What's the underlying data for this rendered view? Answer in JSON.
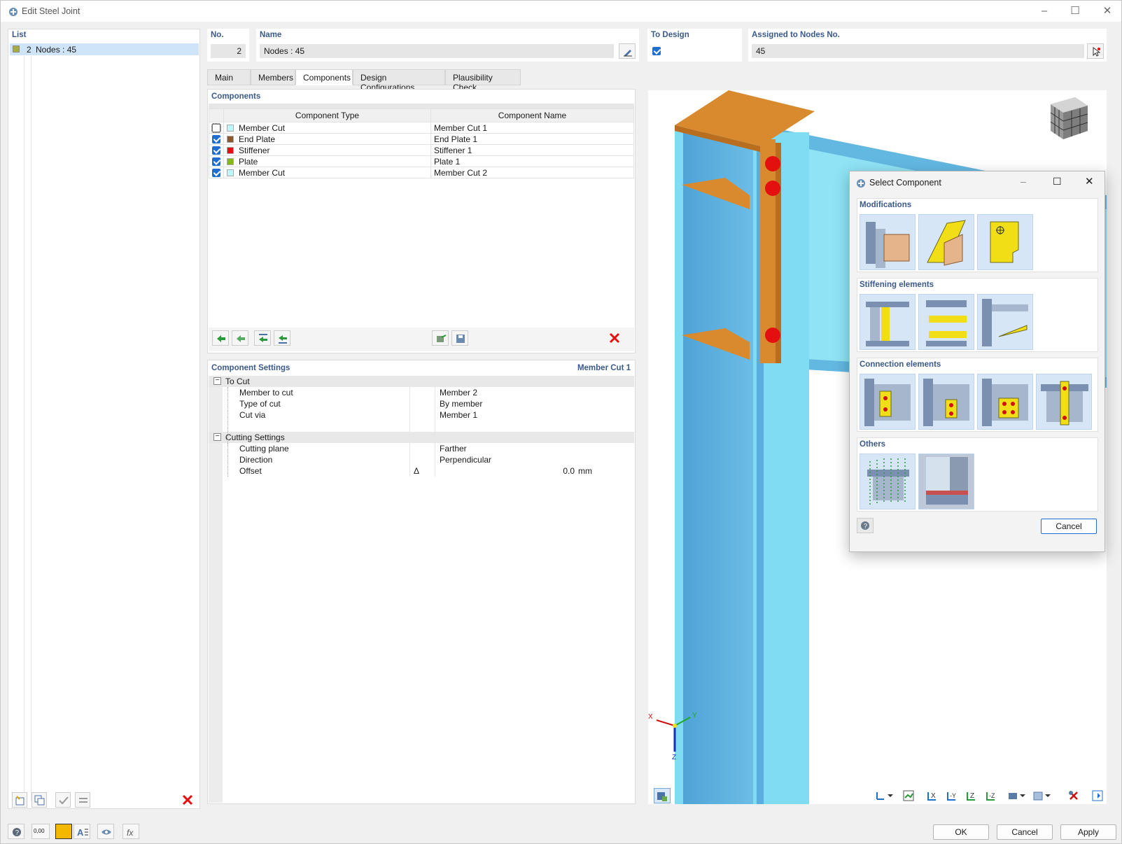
{
  "window": {
    "title": "Edit Steel Joint",
    "icon": "steel-joint-icon"
  },
  "list": {
    "header": "List",
    "item": {
      "number": "2",
      "name": "Nodes : 45",
      "color": "#a6ad3e"
    }
  },
  "no": {
    "label": "No.",
    "value": "2"
  },
  "name": {
    "label": "Name",
    "value": "Nodes : 45"
  },
  "to_design": {
    "label": "To Design",
    "checked": true
  },
  "assigned": {
    "label": "Assigned to Nodes No.",
    "value": "45"
  },
  "tabs": [
    {
      "label": "Main",
      "active": false
    },
    {
      "label": "Members",
      "active": false
    },
    {
      "label": "Components",
      "active": true
    },
    {
      "label": "Design Configurations",
      "active": false
    },
    {
      "label": "Plausibility Check",
      "active": false
    }
  ],
  "components": {
    "header": "Components",
    "col_type": "Component Type",
    "col_name": "Component Name",
    "rows": [
      {
        "checked": false,
        "color": "#bff6fb",
        "type": "Member Cut",
        "name": "Member Cut 1"
      },
      {
        "checked": true,
        "color": "#8a5a2e",
        "type": "End Plate",
        "name": "End Plate 1"
      },
      {
        "checked": true,
        "color": "#e3100f",
        "type": "Stiffener",
        "name": "Stiffener 1"
      },
      {
        "checked": true,
        "color": "#86b817",
        "type": "Plate",
        "name": "Plate 1"
      },
      {
        "checked": true,
        "color": "#bff6fb",
        "type": "Member Cut",
        "name": "Member Cut 2"
      }
    ]
  },
  "settings": {
    "header": "Component Settings",
    "current": "Member Cut 1",
    "groups": [
      {
        "title": "To Cut",
        "rows": [
          {
            "label": "Member to cut",
            "symbol": "",
            "value": "Member 2",
            "unit": ""
          },
          {
            "label": "Type of cut",
            "symbol": "",
            "value": "By member",
            "unit": ""
          },
          {
            "label": "Cut via",
            "symbol": "",
            "value": "Member 1",
            "unit": ""
          }
        ]
      },
      {
        "title": "Cutting Settings",
        "rows": [
          {
            "label": "Cutting plane",
            "symbol": "",
            "value": "Farther",
            "unit": ""
          },
          {
            "label": "Direction",
            "symbol": "",
            "value": "Perpendicular",
            "unit": ""
          },
          {
            "label": "Offset",
            "symbol": "Δ",
            "value": "0.0",
            "unit": "mm"
          }
        ]
      }
    ]
  },
  "axes": {
    "x": "X",
    "y": "Y",
    "z": "Z"
  },
  "select_dialog": {
    "title": "Select Component",
    "sections": [
      {
        "title": "Modifications",
        "count": 3
      },
      {
        "title": "Stiffening elements",
        "count": 3
      },
      {
        "title": "Connection elements",
        "count": 4
      },
      {
        "title": "Others",
        "count": 2
      }
    ],
    "cancel": "Cancel"
  },
  "footer": {
    "ok": "OK",
    "cancel": "Cancel",
    "apply": "Apply",
    "number_icon_text": "0,00"
  },
  "colors": {
    "accent": "#1f6fcf",
    "header_blue": "#3b5a8c",
    "steel_blue": "#5aaedf",
    "plate_orange": "#d98a2e",
    "bolt_red": "#e3100f"
  }
}
